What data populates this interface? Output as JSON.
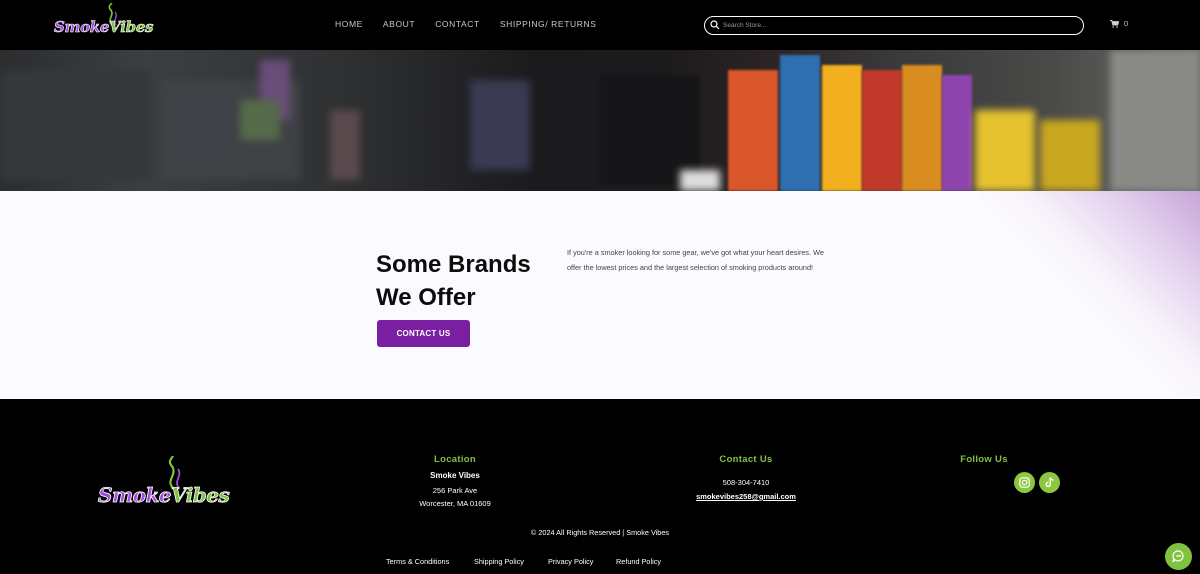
{
  "header": {
    "logo": {
      "part1": "Smoke",
      "part2": "Vibes"
    },
    "nav": [
      "HOME",
      "ABOUT",
      "CONTACT",
      "SHIPPING/ RETURNS"
    ],
    "search_placeholder": "Search Store...",
    "cart_count": "0"
  },
  "hero": {
    "icon": "shelf-photo"
  },
  "main": {
    "heading_line1": "Some Brands",
    "heading_line2": "We Offer",
    "cta_label": "CONTACT US",
    "description": "If you're a smoker looking for some gear, we've got what your heart desires. We offer the lowest prices and the largest selection of smoking products around!"
  },
  "footer": {
    "logo": {
      "part1": "Smoke",
      "part2": "Vibes"
    },
    "location": {
      "title": "Location",
      "name": "Smoke Vibes",
      "address1": "256 Park Ave",
      "address2": "Worcester, MA 01609"
    },
    "contact": {
      "title": "Contact Us",
      "phone": "508-304-7410",
      "email": "smokevibes258@gmail.com"
    },
    "follow": {
      "title": "Follow Us"
    },
    "copyright": "© 2024 All Rights Reserved | Smoke Vibes",
    "legal": [
      "Terms & Conditions",
      "Shipping Policy",
      "Privacy Policy",
      "Refund Policy"
    ]
  },
  "colors": {
    "accent_green": "#7fc241",
    "accent_purple": "#7b1fa2",
    "background": "#000000"
  }
}
